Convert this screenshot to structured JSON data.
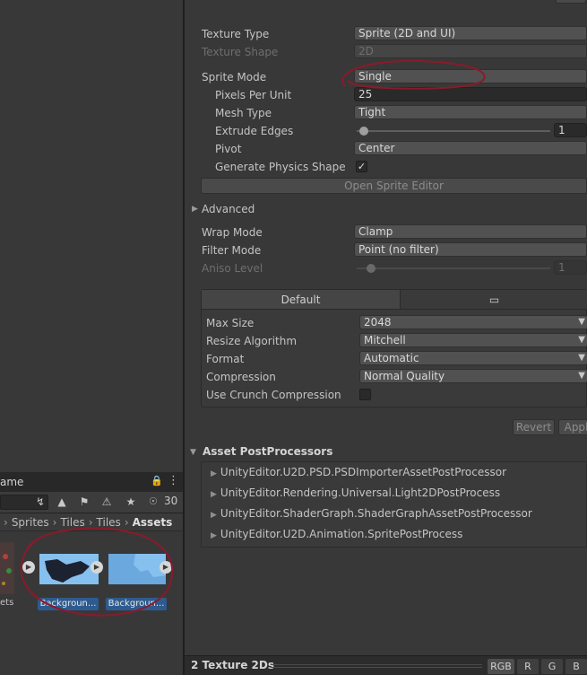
{
  "project": {
    "panel_title": "ame",
    "toolbar": {
      "visibility_count": "30"
    },
    "breadcrumb": [
      "Sprites",
      "Tiles",
      "Tiles",
      "Assets"
    ],
    "items": [
      {
        "label": "ets"
      },
      {
        "label": "Backgroun..."
      },
      {
        "label": "Backgroun..."
      }
    ]
  },
  "inspector": {
    "header_button": "",
    "texture_type": {
      "label": "Texture Type",
      "value": "Sprite (2D and UI)"
    },
    "texture_shape": {
      "label": "Texture Shape",
      "value": "2D"
    },
    "sprite_mode": {
      "label": "Sprite Mode",
      "value": "Single"
    },
    "pixels_per_unit": {
      "label": "Pixels Per Unit",
      "value": "25"
    },
    "mesh_type": {
      "label": "Mesh Type",
      "value": "Tight"
    },
    "extrude_edges": {
      "label": "Extrude Edges",
      "value": "1"
    },
    "pivot": {
      "label": "Pivot",
      "value": "Center"
    },
    "generate_physics_shape": {
      "label": "Generate Physics Shape",
      "checked": true
    },
    "open_sprite_editor": "Open Sprite Editor",
    "advanced": "Advanced",
    "wrap_mode": {
      "label": "Wrap Mode",
      "value": "Clamp"
    },
    "filter_mode": {
      "label": "Filter Mode",
      "value": "Point (no filter)"
    },
    "aniso_level": {
      "label": "Aniso Level",
      "value": "1"
    },
    "platform_tabs": {
      "default": "Default"
    },
    "max_size": {
      "label": "Max Size",
      "value": "2048"
    },
    "resize_algorithm": {
      "label": "Resize Algorithm",
      "value": "Mitchell"
    },
    "format": {
      "label": "Format",
      "value": "Automatic"
    },
    "compression": {
      "label": "Compression",
      "value": "Normal Quality"
    },
    "use_crunch": {
      "label": "Use Crunch Compression",
      "checked": false
    },
    "revert_button": "Revert",
    "apply_button": "Appl",
    "post_processors": {
      "title": "Asset PostProcessors",
      "items": [
        "UnityEditor.U2D.PSD.PSDImporterAssetPostProcessor",
        "UnityEditor.Rendering.Universal.Light2DPostProcess",
        "UnityEditor.ShaderGraph.ShaderGraphAssetPostProcessor",
        "UnityEditor.U2D.Animation.SpritePostProcess"
      ]
    },
    "status": {
      "title": "2 Texture 2Ds",
      "channels": [
        "RGB",
        "R",
        "G",
        "B"
      ]
    }
  },
  "colors": {
    "annotation": "#8b1a2b",
    "selection_label": "#2e5b8f",
    "panel_bg": "#383838"
  }
}
